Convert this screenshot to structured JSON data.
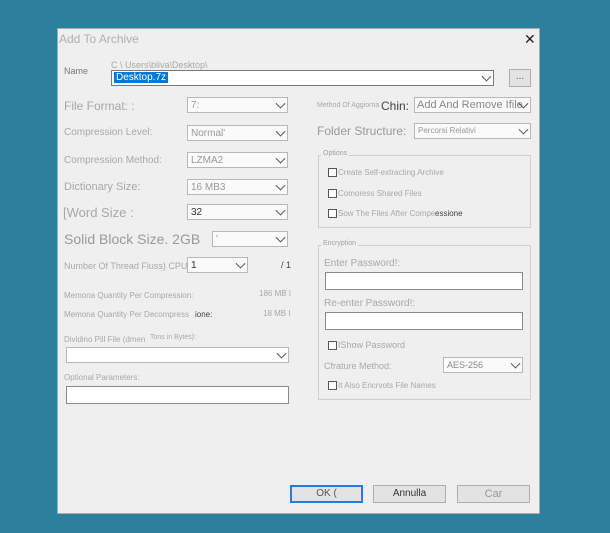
{
  "window": {
    "title": "Add To Archive",
    "close_glyph": "✕"
  },
  "name": {
    "label": "Name",
    "path": "C  \\ Users\\bliva\\Desktop\\",
    "value": "Desktop.7z",
    "browse_label": "..."
  },
  "left": {
    "file_format": {
      "label": "File Format: :",
      "value": "7:"
    },
    "compression_level": {
      "label": "Compression Level:",
      "value": "Normal'"
    },
    "compression_method": {
      "label": "Compression Method:",
      "value": "LZMA2"
    },
    "dictionary_size": {
      "label": "Dictionary Size:",
      "value": "16 MB3"
    },
    "word_size": {
      "label": "[Word Size :",
      "value": "32"
    },
    "solid_block": {
      "label": "Solid Block Size. 2GB",
      "value": "'"
    },
    "threads": {
      "label": "Number Of Thread Fluss) CPU:",
      "value": "1",
      "max": "/ 1"
    },
    "mem_compress": {
      "label": "Memona Quantity Per Compression:",
      "value": "186 MB I"
    },
    "mem_decompress": {
      "label": "Memona Quantity Per Decompress",
      "label2": "ione:",
      "value": "18 MB I"
    },
    "split": {
      "label": "Dividino Pill File (dmen",
      "label2": "Tons in Bytes):",
      "value": ""
    },
    "params": {
      "label": "Optional Parameters:",
      "value": ""
    }
  },
  "right": {
    "update_method": {
      "label": "Method Of Aggiorna",
      "label2": "Chin:",
      "value": "Add And Remove Ifile"
    },
    "folder_structure": {
      "label": "Folder Structure:",
      "value": "Percorsi Relativi"
    },
    "options": {
      "title": "Options",
      "sfx": "Create Self-extracting Archive",
      "shared": "Comoress Shared Files",
      "delete": "Sow The Files After Compe",
      "delete2": "essione"
    },
    "encryption": {
      "title": "Encryption",
      "enter_label": "Enter Password!:",
      "enter_value": "",
      "reenter_label": "Re-enter Password!:",
      "reenter_value": "",
      "show": "IShow Password",
      "method_label": "Cfrature Method:",
      "method_value": "AES-256",
      "encrypt_names": "It Also Encrvots File Names"
    }
  },
  "buttons": {
    "ok": "OK (",
    "cancel": "Annulla",
    "help": "Car"
  },
  "colors": {
    "desktop": "#2d7f9e",
    "selection": "#0078d7",
    "default_border": "#2b7bd6"
  }
}
